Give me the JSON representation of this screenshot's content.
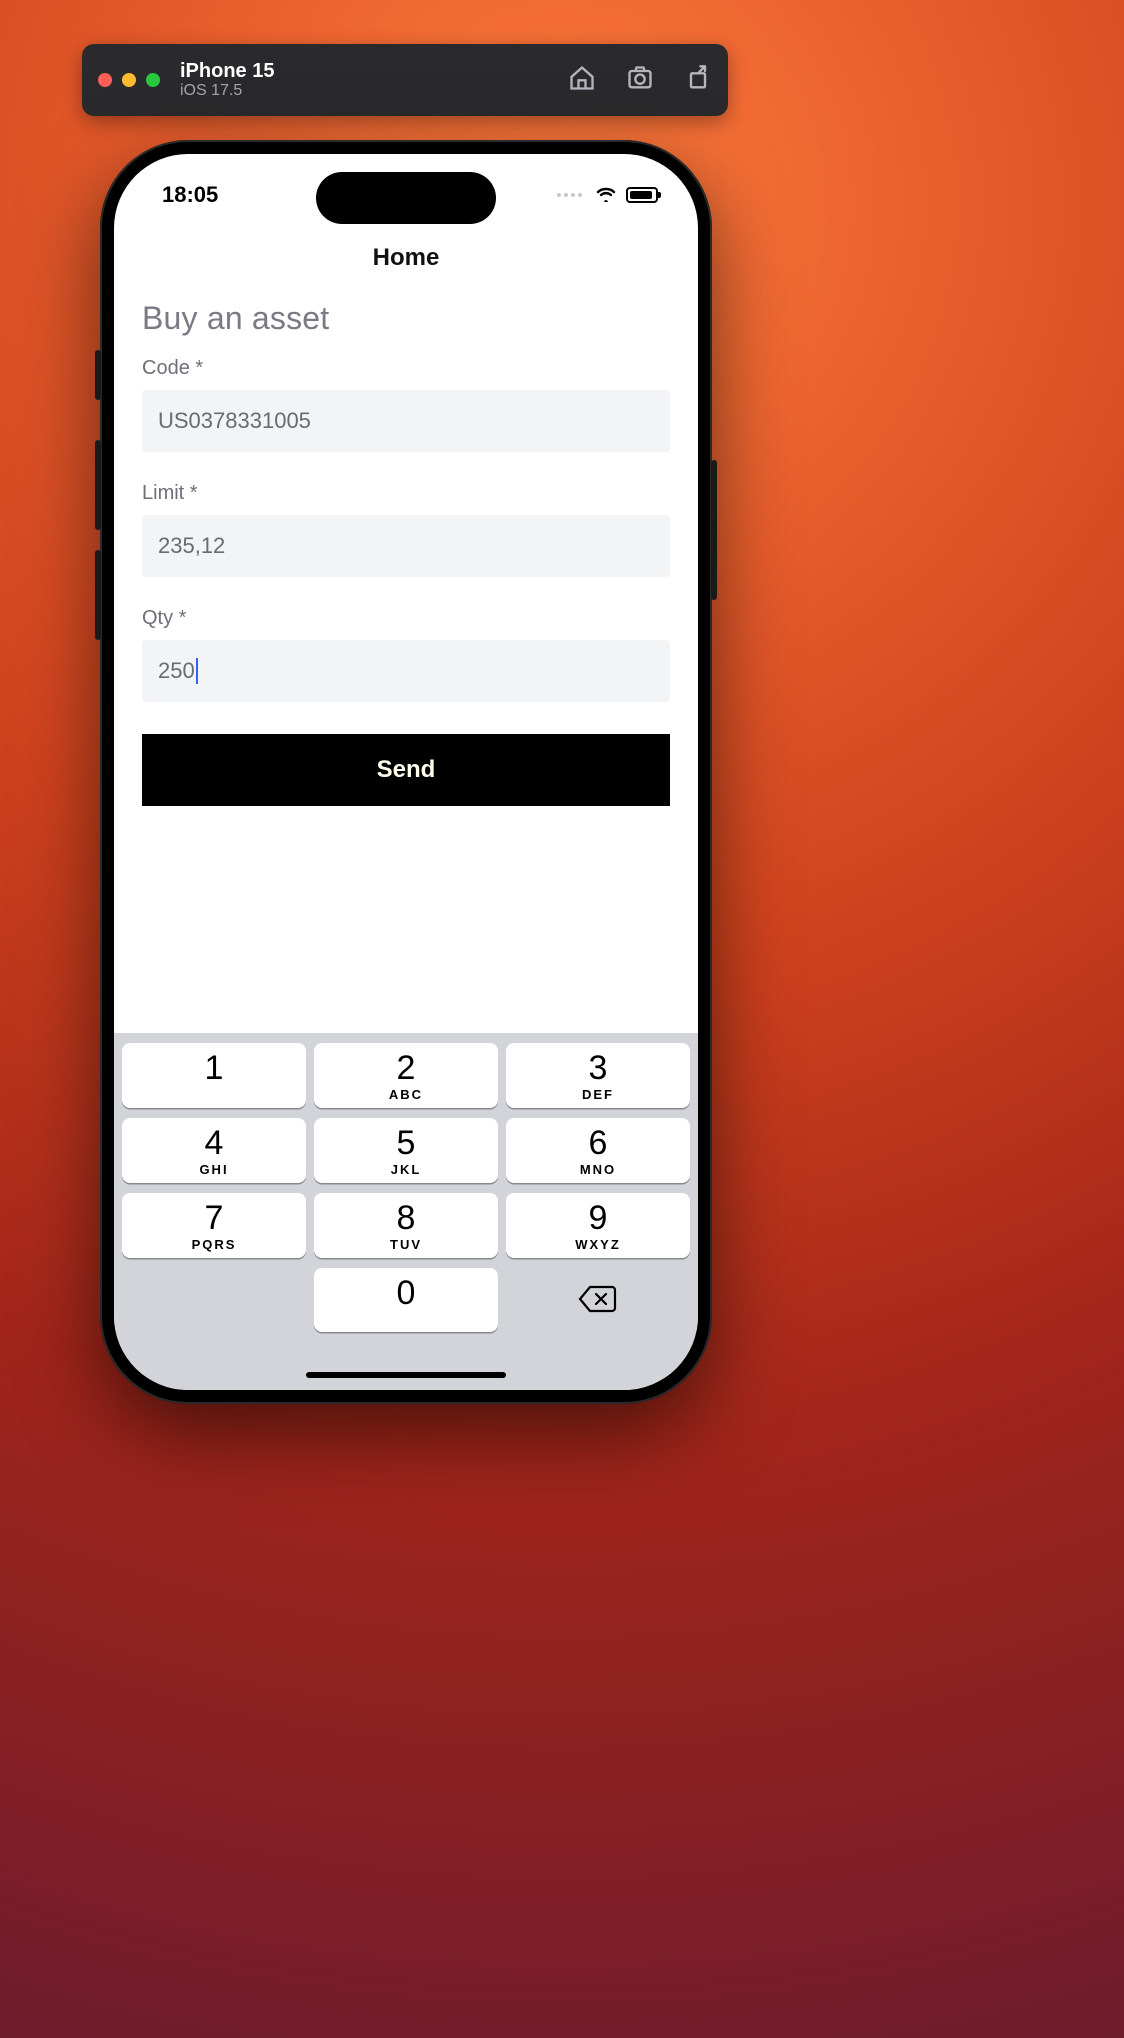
{
  "simulator": {
    "device": "iPhone 15",
    "os": "iOS 17.5"
  },
  "status": {
    "time": "18:05"
  },
  "nav": {
    "title": "Home"
  },
  "form": {
    "heading": "Buy an asset",
    "code_label": "Code *",
    "code_value": "US0378331005",
    "limit_label": "Limit *",
    "limit_value": "235,12",
    "qty_label": "Qty *",
    "qty_value": "250",
    "send_label": "Send"
  },
  "keypad": {
    "keys": [
      {
        "num": "1",
        "letters": ""
      },
      {
        "num": "2",
        "letters": "ABC"
      },
      {
        "num": "3",
        "letters": "DEF"
      },
      {
        "num": "4",
        "letters": "GHI"
      },
      {
        "num": "5",
        "letters": "JKL"
      },
      {
        "num": "6",
        "letters": "MNO"
      },
      {
        "num": "7",
        "letters": "PQRS"
      },
      {
        "num": "8",
        "letters": "TUV"
      },
      {
        "num": "9",
        "letters": "WXYZ"
      },
      {
        "num": "0",
        "letters": ""
      }
    ]
  }
}
